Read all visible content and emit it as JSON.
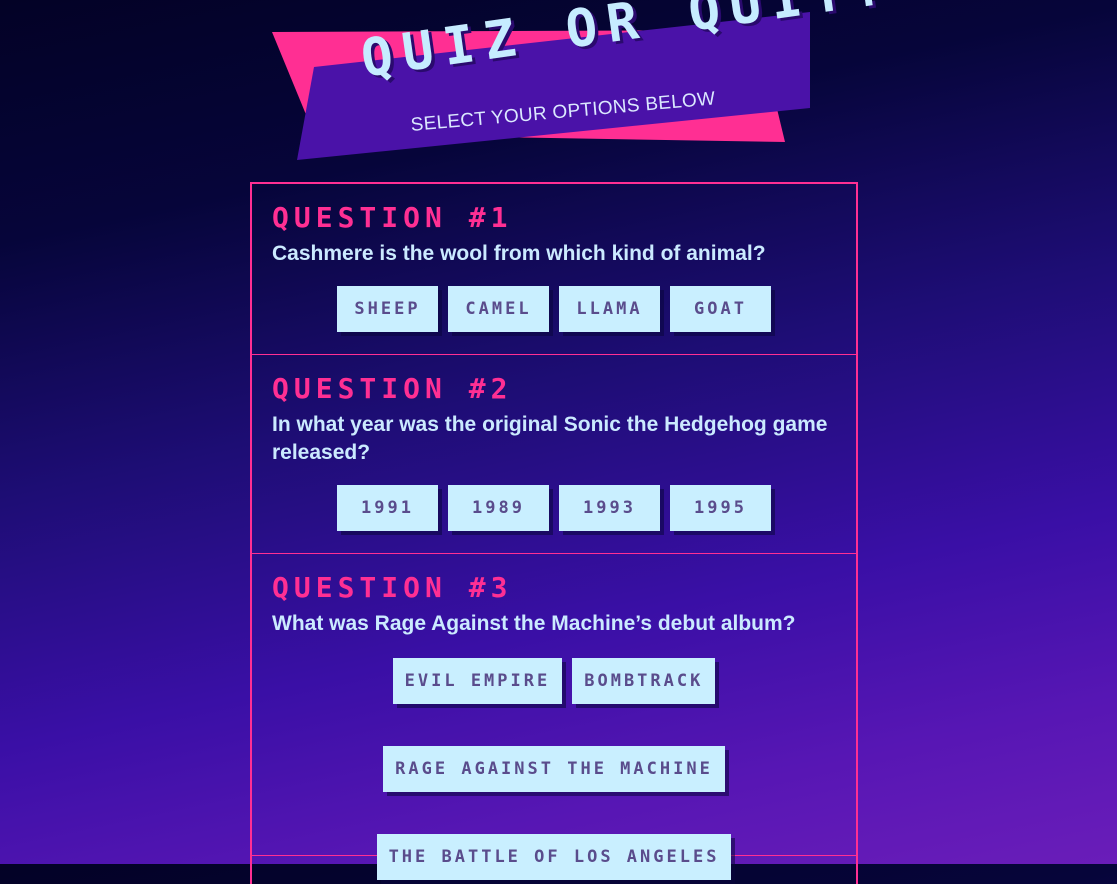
{
  "banner": {
    "title": "QUIZ OR QUIT?",
    "subtitle": "SELECT YOUR OPTIONS BELOW"
  },
  "colors": {
    "accent_pink": "#ff2f93",
    "banner_purple": "#4a12a8",
    "option_bg": "#c9efff",
    "option_text": "#5a4c8c",
    "question_text": "#cbeaff",
    "background_top": "#030226",
    "background_bottom": "#6a1db9"
  },
  "questions": [
    {
      "label": "QUESTION #1",
      "text": "Cashmere is the wool from which kind of animal?",
      "options": [
        "SHEEP",
        "CAMEL",
        "LLAMA",
        "GOAT"
      ]
    },
    {
      "label": "QUESTION #2",
      "text": "In what year was the original Sonic the Hedgehog game released?",
      "options": [
        "1991",
        "1989",
        "1993",
        "1995"
      ]
    },
    {
      "label": "QUESTION #3",
      "text": "What was Rage Against the Machine’s debut album?",
      "options": [
        "EVIL EMPIRE",
        "BOMBTRACK",
        "RAGE AGAINST THE MACHINE",
        "THE BATTLE OF LOS ANGELES"
      ]
    }
  ]
}
